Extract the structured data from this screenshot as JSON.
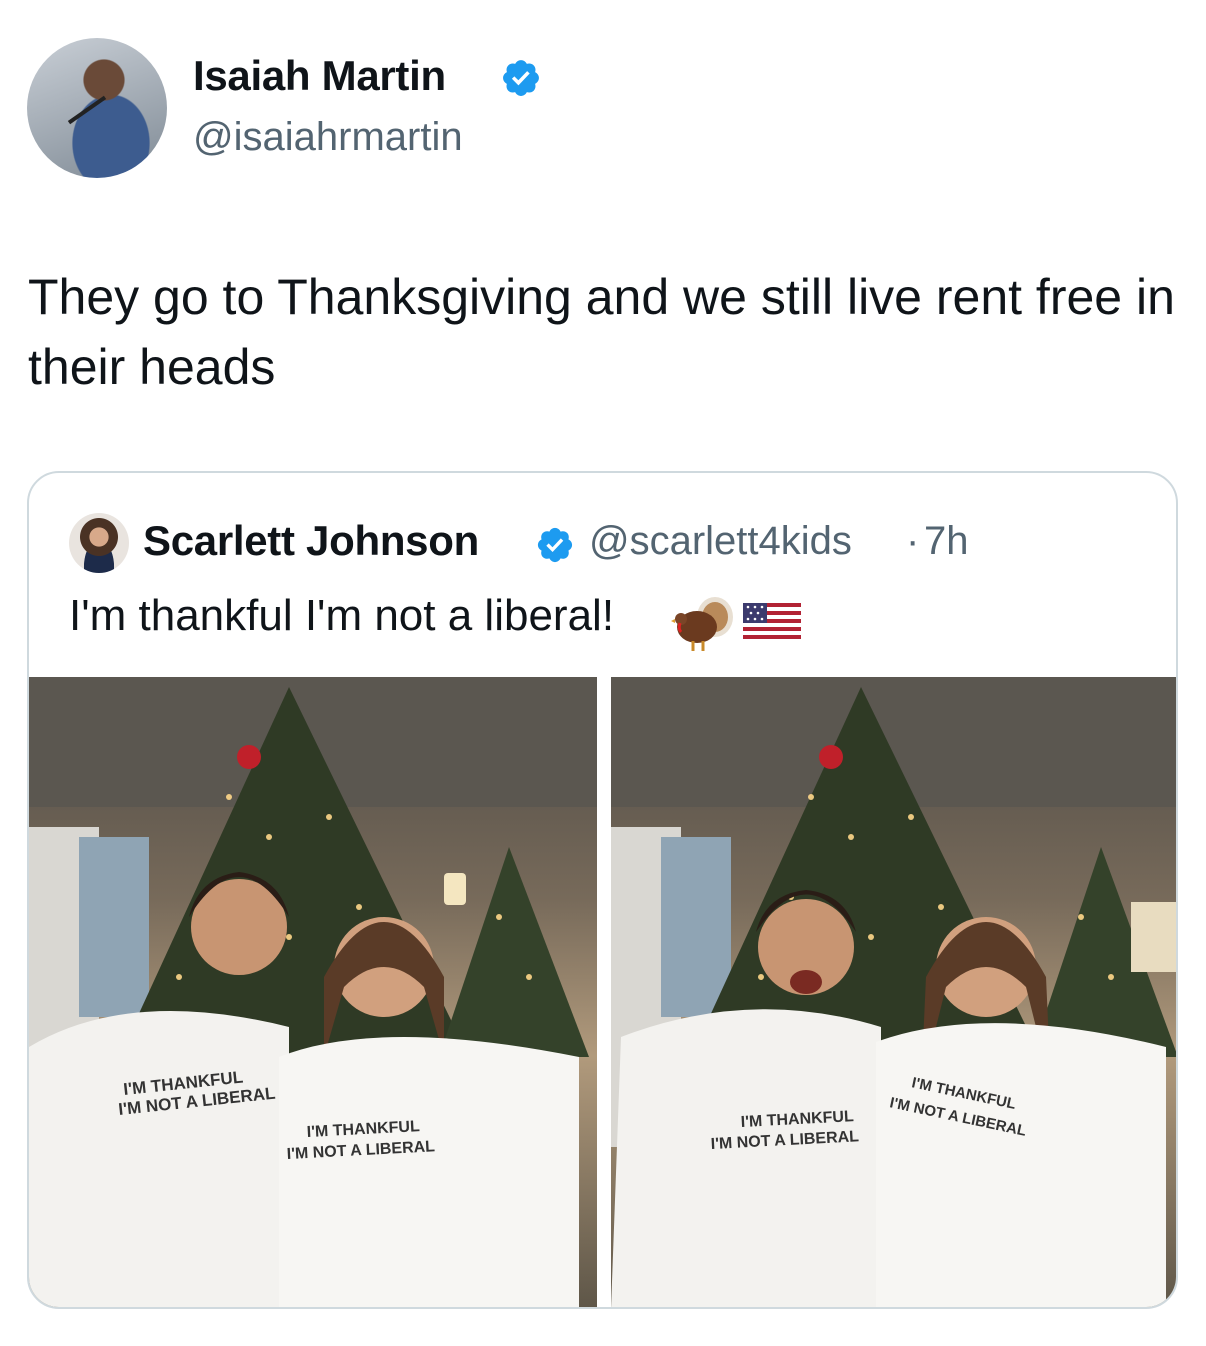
{
  "tweet": {
    "author": {
      "name": "Isaiah Martin",
      "handle": "@isaiahrmartin",
      "verified": true
    },
    "text": "They go to Thanksgiving and we still live rent free in their heads"
  },
  "quoted_tweet": {
    "author": {
      "name": "Scarlett Johnson",
      "handle": "@scarlett4kids",
      "verified": true
    },
    "separator": "·",
    "time": "7h",
    "text": "I'm thankful I'm not a liberal!",
    "emojis": [
      "turkey-icon",
      "us-flag-icon"
    ],
    "photos": [
      {
        "shirt_left": [
          "I'M THANKFUL",
          "I'M NOT A LIBERAL"
        ],
        "shirt_right": [
          "I'M THANKFUL",
          "I'M NOT A LIBERAL"
        ]
      },
      {
        "shirt_left": [
          "I'M THANKFUL",
          "I'M NOT A LIBERAL"
        ],
        "shirt_right": [
          "I'M THANKFUL",
          "I'M NOT A LIBERAL"
        ]
      }
    ]
  },
  "colors": {
    "verified": "#1d9bf0",
    "secondary_text": "#536471",
    "border": "#cfd9de"
  }
}
